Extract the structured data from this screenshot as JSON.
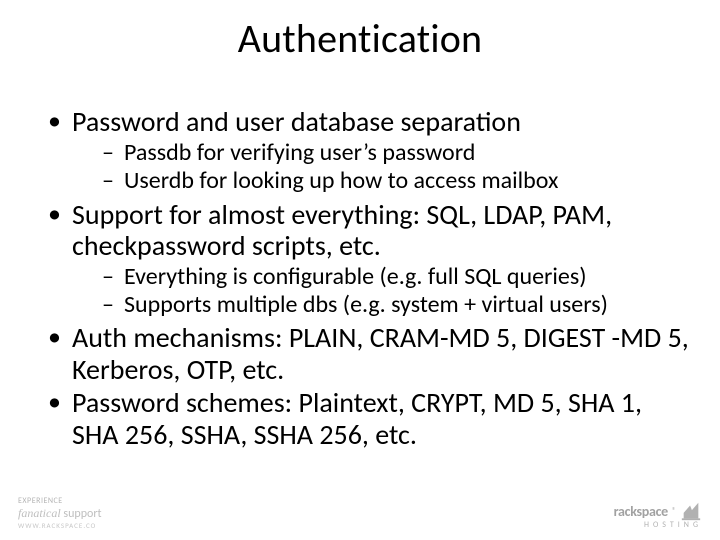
{
  "title": "Authentication",
  "bullets": {
    "b1": "Password and user database separation",
    "b1a": "Passdb for verifying user’s password",
    "b1b": "Userdb for looking up how to access mailbox",
    "b2": "Support for almost everything: SQL, LDAP, PAM, checkpassword scripts, etc.",
    "b2a": "Everything is configurable (e.g. full SQL queries)",
    "b2b": "Supports multiple dbs (e.g. system + virtual users)",
    "b3": "Auth mechanisms: PLAIN, CRAM-MD 5, DIGEST -MD 5, Kerberos, OTP, etc.",
    "b4": "Password schemes: Plaintext, CRYPT, MD 5, SHA 1, SHA 256, SSHA, SSHA 256, etc."
  },
  "footer": {
    "experience": "EXPERIENCE",
    "fanatical": "fanatical",
    "support": "support",
    "url": "WWW.RACKSPACE.CO",
    "brand": "rackspace",
    "hosting": "HOSTING"
  }
}
